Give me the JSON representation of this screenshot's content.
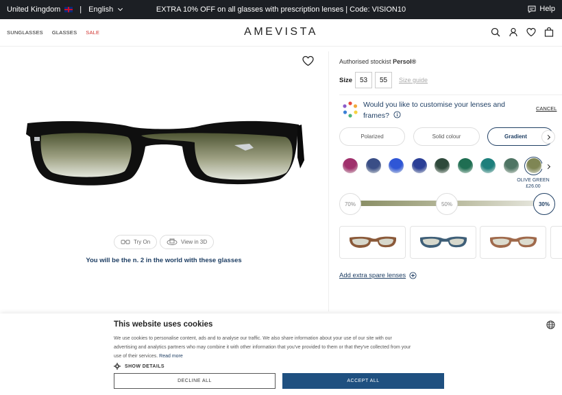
{
  "topbar": {
    "country": "United Kingdom",
    "language": "English",
    "promo": "EXTRA 10% OFF on all glasses with prescription lenses | Code: VISION10",
    "help": "Help"
  },
  "nav": {
    "sunglasses": "SUNGLASSES",
    "glasses": "GLASSES",
    "sale": "SALE"
  },
  "brand": {
    "logo": "AMEVISTA"
  },
  "product": {
    "try_on": "Try On",
    "view_3d": "View in 3D",
    "rank_text": "You will be the n. 2 in the world with these glasses"
  },
  "config": {
    "stockist_prefix": "Authorised stockist",
    "stockist_brand": "Persol®",
    "size_label": "Size",
    "sizes": [
      "53",
      "55"
    ],
    "size_guide": "Size guide",
    "customise_question": "Would you like to customise your lenses and frames?",
    "cancel": "CANCEL",
    "tint_tabs": [
      "Polarized",
      "Solid colour",
      "Gradient"
    ],
    "active_tint": "Gradient",
    "swatch_colors": [
      "#a0306c",
      "#3a4e86",
      "#2f56d6",
      "#2b3f96",
      "#2f4a3c",
      "#1f6e52",
      "#1d7f7c",
      "#4f7564",
      "#7f8654"
    ],
    "selected_swatch_name": "OLIVE GREEN",
    "selected_swatch_price": "£26.00",
    "gradient_levels": [
      "70%",
      "50%",
      "30%"
    ],
    "active_gradient": "30%",
    "add_lenses": "Add extra spare lenses"
  },
  "cookie": {
    "title": "This website uses cookies",
    "text": "We use cookies to personalise content, ads and to analyse our traffic. We also share information about your use of our site with our advertising and analytics partners who may combine it with other information that you've provided to them or that they've collected from your use of their services.",
    "read_more": "Read more",
    "show_details": "SHOW DETAILS",
    "decline": "DECLINE ALL",
    "accept": "ACCEPT ALL"
  }
}
